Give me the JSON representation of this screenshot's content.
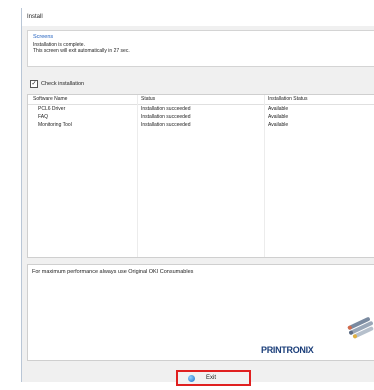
{
  "window": {
    "title": "Install"
  },
  "info": {
    "heading": "Screens",
    "line1": "Installation is complete.",
    "line2": "This screen will exit automatically in 27 sec."
  },
  "check_installation": {
    "label": "Check installation",
    "checked": true,
    "mark": "✓"
  },
  "table": {
    "headers": [
      "Software Name",
      "Status",
      "Installation Status"
    ],
    "rows": [
      [
        "PCL6 Driver",
        "Installation succeeded",
        "Available"
      ],
      [
        "FAQ",
        "Installation succeeded",
        "Available"
      ],
      [
        "Monitoring Tool",
        "Installation succeeded",
        "Available"
      ]
    ]
  },
  "promo": {
    "text": "For maximum performance always use Original OKI Consumables",
    "brand": "PRINTRONIX"
  },
  "exit_button": {
    "label": "Exit",
    "highlight_color": "#e02020"
  }
}
